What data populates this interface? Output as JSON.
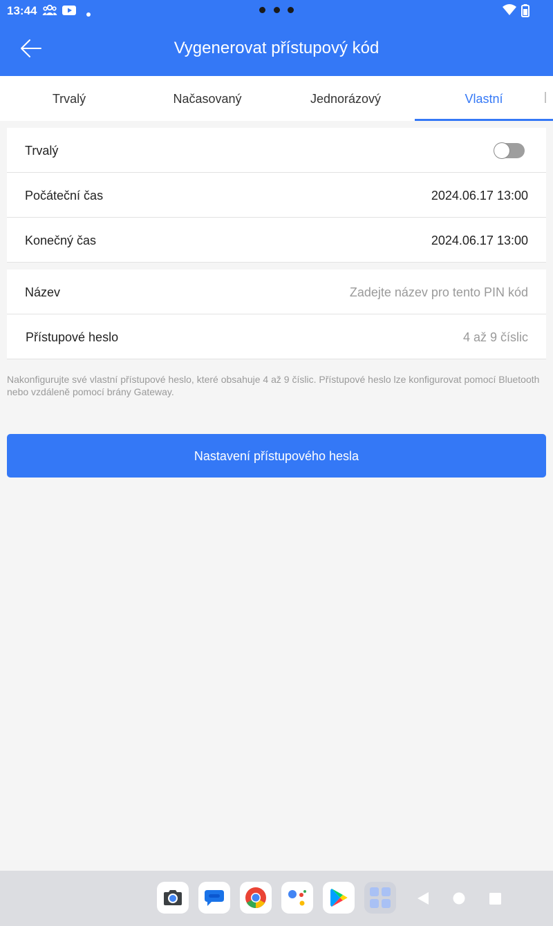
{
  "status_bar": {
    "time": "13:44",
    "icons": [
      "people-icon",
      "youtube-icon",
      "dot-icon",
      "wifi-icon",
      "battery-icon"
    ]
  },
  "header": {
    "title": "Vygenerovat přístupový kód",
    "back_icon": "arrow-left-icon",
    "background": "#3478f6"
  },
  "tabs": [
    {
      "label": "Trvalý",
      "active": false
    },
    {
      "label": "Načasovaný",
      "active": false
    },
    {
      "label": "Jednorázový",
      "active": false
    },
    {
      "label": "Vlastní",
      "active": true
    }
  ],
  "time_settings": {
    "permanent": {
      "label": "Trvalý",
      "enabled": false
    },
    "start": {
      "label": "Počáteční čas",
      "value": "2024.06.17 13:00"
    },
    "end": {
      "label": "Konečný čas",
      "value": "2024.06.17 13:00"
    }
  },
  "details": {
    "name": {
      "label": "Název",
      "placeholder": "Zadejte název pro tento PIN kód"
    },
    "password": {
      "label": "Přístupové heslo",
      "placeholder": "4 až 9 číslic"
    }
  },
  "hint": "Nakonfigurujte své vlastní přístupové heslo, které obsahuje 4 až 9 číslic. Přístupové heslo lze konfigurovat pomocí Bluetooth nebo vzdáleně pomocí brány Gateway.",
  "submit_button": "Nastavení přístupového hesla",
  "dock": {
    "apps": [
      "camera-icon",
      "messages-icon",
      "chrome-icon",
      "assistant-icon",
      "play-store-icon",
      "app-drawer-icon"
    ],
    "nav": [
      "back-triangle-icon",
      "home-circle-icon",
      "recents-square-icon"
    ]
  },
  "colors": {
    "accent": "#3478f6",
    "background": "#f5f5f5",
    "placeholder": "#9a9a9a"
  }
}
